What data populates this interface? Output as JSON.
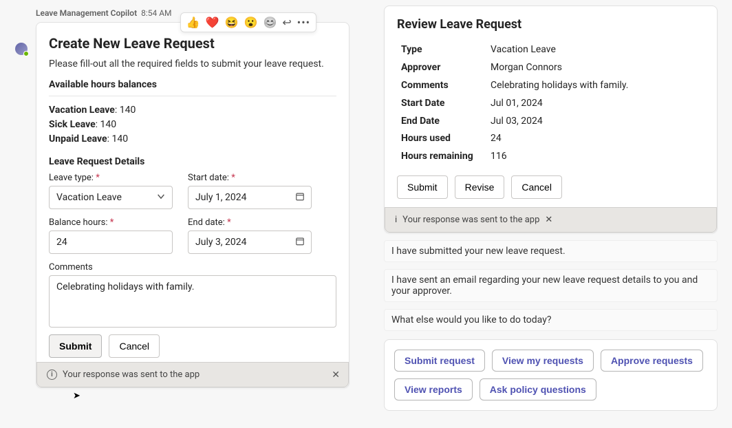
{
  "left": {
    "sender": "Leave Management Copilot",
    "time": "8:54 AM",
    "reactions": {
      "emoji1": "👍",
      "emoji2": "❤️",
      "emoji3": "😆",
      "emoji4": "😮"
    },
    "card": {
      "title": "Create New Leave Request",
      "intro": "Please fill-out all the required fields to submit your leave request.",
      "balances_head": "Available hours balances",
      "balances": [
        {
          "label": "Vacation Leave",
          "value": "140"
        },
        {
          "label": "Sick Leave",
          "value": "140"
        },
        {
          "label": "Unpaid Leave",
          "value": "140"
        }
      ],
      "details_head": "Leave Request Details",
      "fields": {
        "leave_type_label": "Leave type:",
        "leave_type_value": "Vacation Leave",
        "start_date_label": "Start date:",
        "start_date_value": "July 1, 2024",
        "balance_hours_label": "Balance hours:",
        "balance_hours_value": "24",
        "end_date_label": "End date:",
        "end_date_value": "July 3, 2024",
        "comments_label": "Comments",
        "comments_value": "Celebrating holidays with family."
      },
      "submit": "Submit",
      "cancel": "Cancel",
      "toast": "Your response was sent to the app"
    }
  },
  "right": {
    "title": "Review Leave Request",
    "rows": [
      {
        "k": "Type",
        "v": "Vacation Leave"
      },
      {
        "k": "Approver",
        "v": "Morgan Connors"
      },
      {
        "k": "Comments",
        "v": "Celebrating holidays with family."
      },
      {
        "k": "Start Date",
        "v": "Jul 01, 2024"
      },
      {
        "k": "End Date",
        "v": "Jul 03, 2024"
      },
      {
        "k": "Hours used",
        "v": "24"
      },
      {
        "k": "Hours remaining",
        "v": "116"
      }
    ],
    "buttons": {
      "submit": "Submit",
      "revise": "Revise",
      "cancel": "Cancel"
    },
    "toast": "Your response was sent to the app",
    "msg1": "I have submitted your new leave request.",
    "msg2": "I have sent an email regarding your new leave request details to you and your approver.",
    "msg3": "What else would you like to do today?",
    "chips": [
      "Submit request",
      "View my requests",
      "Approve requests",
      "View reports",
      "Ask policy questions"
    ]
  }
}
